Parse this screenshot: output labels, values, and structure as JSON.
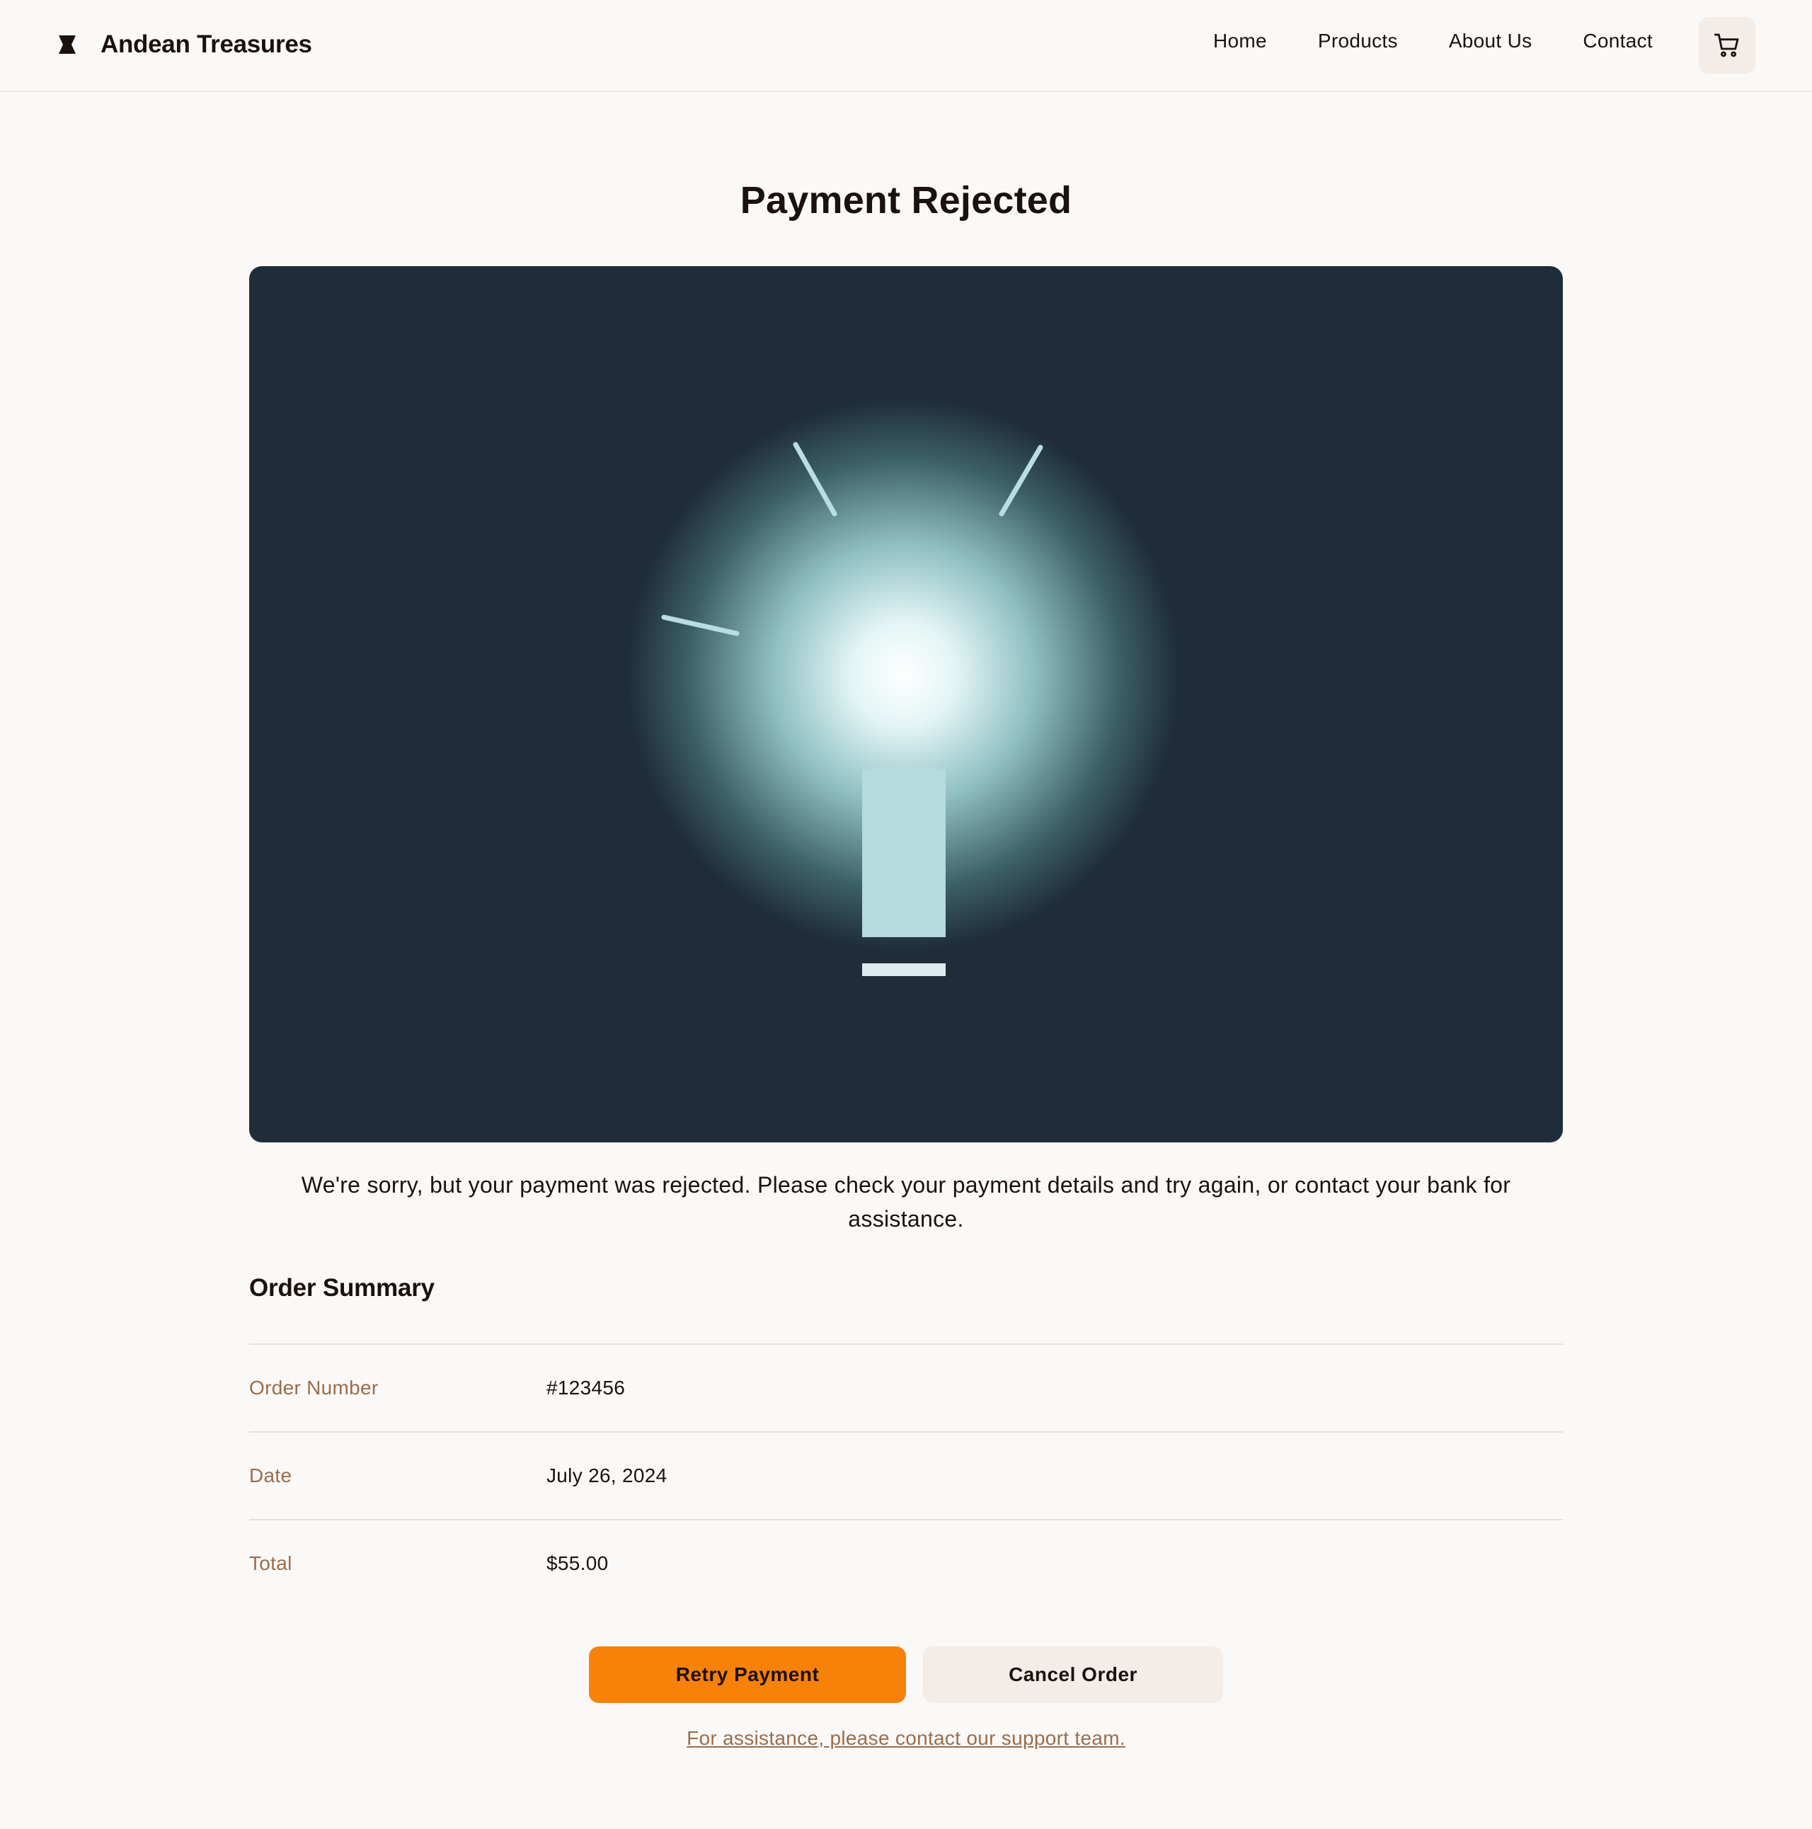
{
  "header": {
    "brand_name": "Andean Treasures",
    "nav": [
      {
        "label": "Home"
      },
      {
        "label": "Products"
      },
      {
        "label": "About Us"
      },
      {
        "label": "Contact"
      }
    ],
    "cart_icon": "shopping-cart-icon"
  },
  "page": {
    "title": "Payment Rejected",
    "message": "We're sorry, but your payment was rejected. Please check your payment details and try again, or contact your bank for assistance."
  },
  "order_summary": {
    "title": "Order Summary",
    "rows": [
      {
        "label": "Order Number",
        "value": "#123456"
      },
      {
        "label": "Date",
        "value": "July 26, 2024"
      },
      {
        "label": "Total",
        "value": "$55.00"
      }
    ]
  },
  "actions": {
    "retry_label": "Retry Payment",
    "cancel_label": "Cancel Order",
    "support_text": "For assistance, please contact our support team."
  },
  "colors": {
    "background": "#fbf9f7",
    "accent": "#f78109",
    "secondary_button": "#f3ece7",
    "label_brown": "#9a6d4b",
    "hero_bg": "#1f2d3b"
  }
}
